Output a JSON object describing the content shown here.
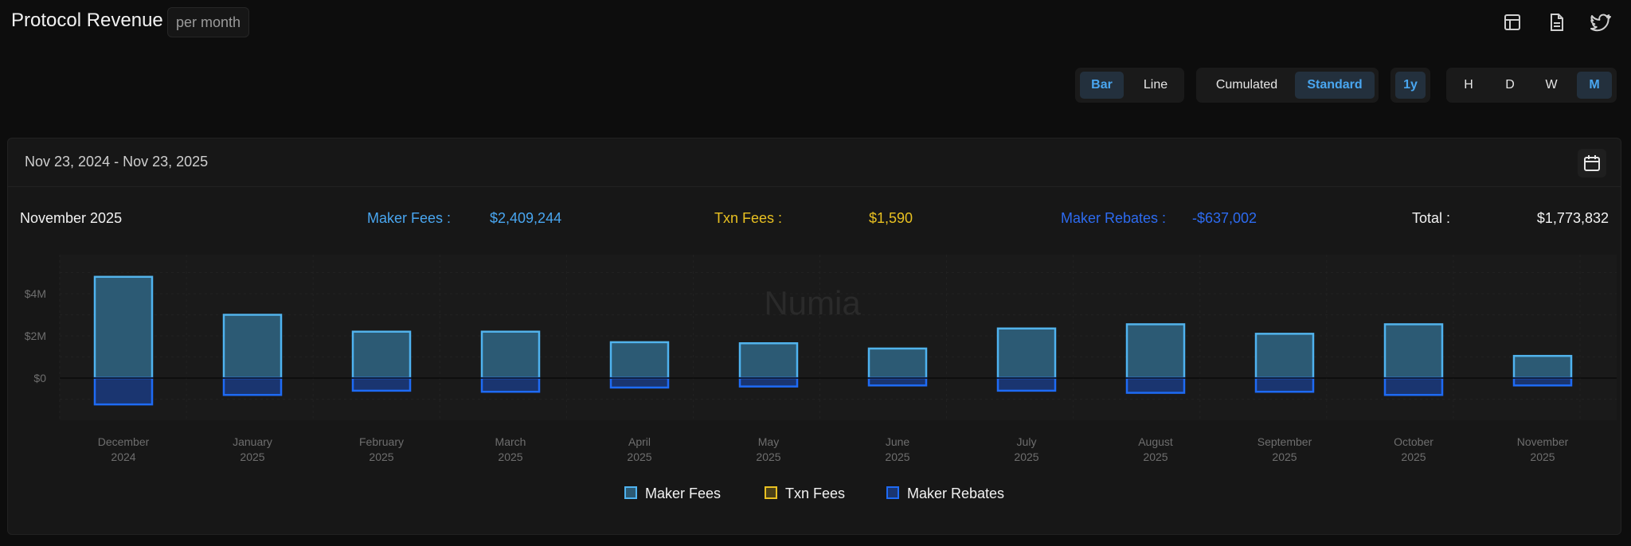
{
  "header": {
    "title": "Protocol Revenue",
    "badge": "per month",
    "icons": [
      "table-icon",
      "document-icon",
      "twitter-icon"
    ]
  },
  "controls": {
    "chart_type": [
      {
        "label": "Bar",
        "active": true
      },
      {
        "label": "Line",
        "active": false
      }
    ],
    "mode": [
      {
        "label": "Cumulated",
        "active": false
      },
      {
        "label": "Standard",
        "active": true
      }
    ],
    "range": [
      {
        "label": "1y",
        "active": true
      }
    ],
    "granularity": [
      {
        "label": "H",
        "active": false
      },
      {
        "label": "D",
        "active": false
      },
      {
        "label": "W",
        "active": false
      },
      {
        "label": "M",
        "active": true
      }
    ]
  },
  "card": {
    "date_range": "Nov 23, 2024 - Nov 23, 2025"
  },
  "summary": {
    "month": "November 2025",
    "maker_fees_label": "Maker Fees :",
    "maker_fees_value": "$2,409,244",
    "txn_fees_label": "Txn Fees :",
    "txn_fees_value": "$1,590",
    "maker_rebates_label": "Maker Rebates :",
    "maker_rebates_value": "-$637,002",
    "total_label": "Total :",
    "total_value": "$1,773,832"
  },
  "colors": {
    "maker_fees": "#4fb3f0",
    "txn_fees": "#e8c021",
    "maker_rebates": "#1e6bf5",
    "background": "#171717"
  },
  "watermark": "Numia",
  "chart_data": {
    "type": "bar",
    "categories": [
      [
        "December",
        "2024"
      ],
      [
        "January",
        "2025"
      ],
      [
        "February",
        "2025"
      ],
      [
        "March",
        "2025"
      ],
      [
        "April",
        "2025"
      ],
      [
        "May",
        "2025"
      ],
      [
        "June",
        "2025"
      ],
      [
        "July",
        "2025"
      ],
      [
        "August",
        "2025"
      ],
      [
        "September",
        "2025"
      ],
      [
        "October",
        "2025"
      ],
      [
        "November",
        "2025"
      ]
    ],
    "series": [
      {
        "name": "Maker Fees",
        "values": [
          4800000,
          3000000,
          2200000,
          2200000,
          1700000,
          1650000,
          1400000,
          2350000,
          2550000,
          2100000,
          2550000,
          1050000
        ]
      },
      {
        "name": "Txn Fees",
        "values": [
          2000,
          1800,
          1600,
          1600,
          1500,
          1500,
          1400,
          1600,
          1700,
          1600,
          1700,
          1590
        ]
      },
      {
        "name": "Maker Rebates",
        "values": [
          -1250000,
          -800000,
          -600000,
          -650000,
          -450000,
          -400000,
          -350000,
          -600000,
          -700000,
          -650000,
          -800000,
          -350000
        ]
      }
    ],
    "y_ticks": [
      "$4M",
      "$2M",
      "$0"
    ],
    "y_tick_values": [
      4000000,
      2000000,
      0
    ],
    "ylim": [
      -2000000,
      6000000
    ],
    "grid": true,
    "stacked": true,
    "legend_position": "bottom-center",
    "xlabel": "",
    "ylabel": ""
  }
}
